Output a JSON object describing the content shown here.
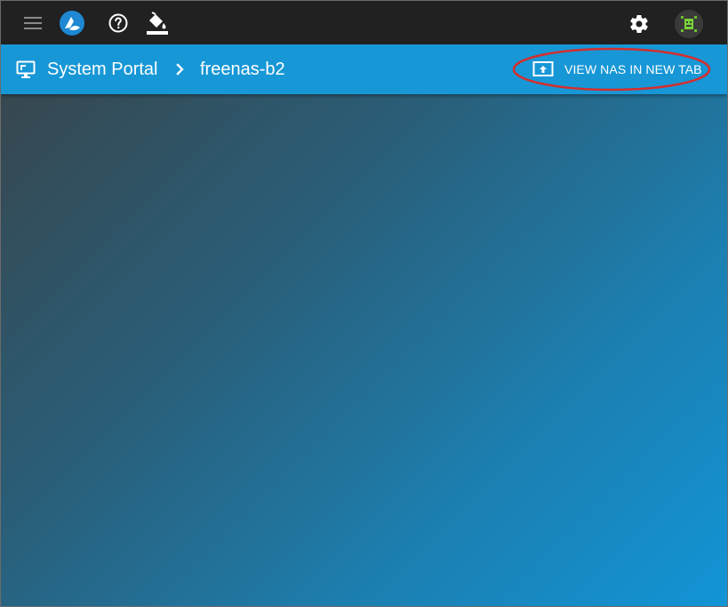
{
  "toolbar": {
    "menu_icon": "menu-icon",
    "logo_icon": "truecommand-logo-icon",
    "help_icon": "help-circle-icon",
    "theme_icon": "paint-bucket-icon",
    "settings_icon": "gear-icon",
    "avatar_icon": "user-avatar-icon"
  },
  "subheader": {
    "breadcrumb_root": "System Portal",
    "breadcrumb_current": "freenas-b2",
    "view_button_label": "VIEW NAS IN NEW TAB"
  },
  "colors": {
    "toolbar_bg": "#212121",
    "subheader_bg": "#1797d6",
    "annotation": "#d32f2f",
    "content_gradient_start": "#37474f",
    "content_gradient_end": "#1294d6"
  }
}
